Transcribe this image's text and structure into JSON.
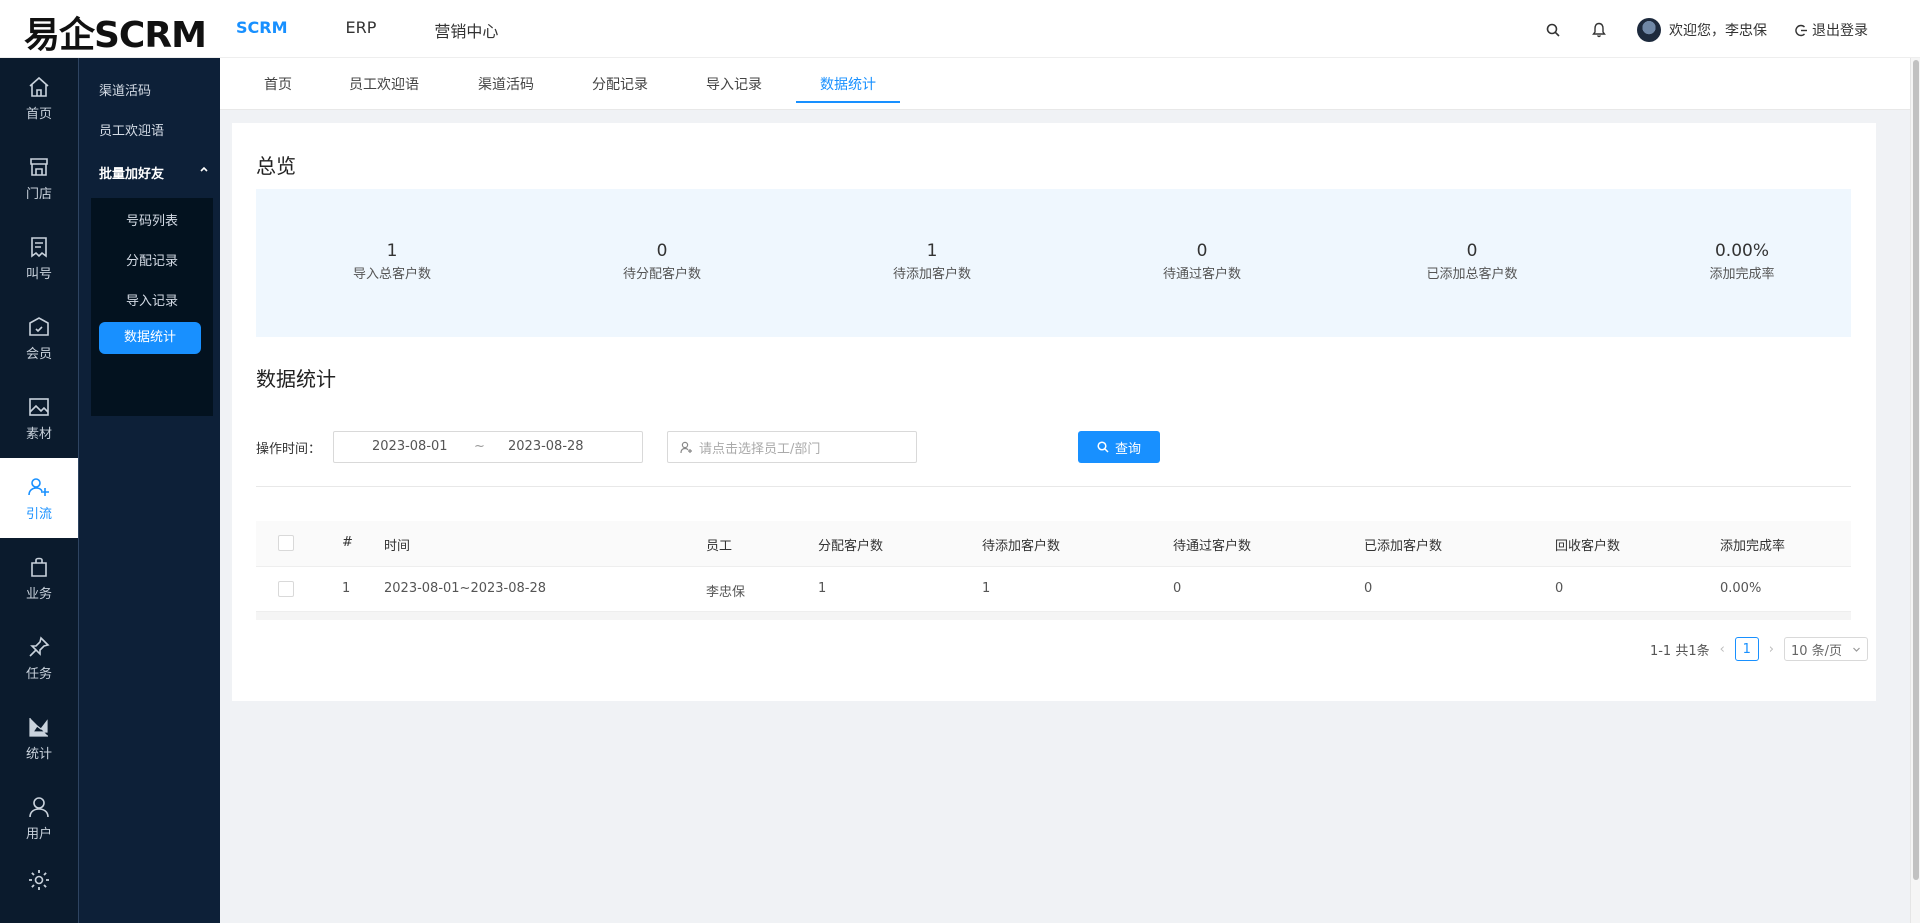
{
  "app": {
    "logo": "易企SCRM"
  },
  "topnav": {
    "items": [
      "SCRM",
      "ERP",
      "营销中心"
    ],
    "active": "SCRM"
  },
  "header": {
    "welcome": "欢迎您，李忠保",
    "logout": "退出登录"
  },
  "rail": {
    "items": [
      {
        "label": "首页",
        "icon": "home-icon"
      },
      {
        "label": "门店",
        "icon": "store-icon"
      },
      {
        "label": "叫号",
        "icon": "queue-icon"
      },
      {
        "label": "会员",
        "icon": "member-icon"
      },
      {
        "label": "素材",
        "icon": "image-icon"
      },
      {
        "label": "引流",
        "icon": "users-plus-icon"
      },
      {
        "label": "业务",
        "icon": "bag-icon"
      },
      {
        "label": "任务",
        "icon": "pin-icon"
      },
      {
        "label": "统计",
        "icon": "chart-icon"
      },
      {
        "label": "用户",
        "icon": "user-icon"
      }
    ],
    "active": "引流"
  },
  "submenu": {
    "items": [
      "渠道活码",
      "员工欢迎语"
    ],
    "group": "批量加好友",
    "children": [
      "号码列表",
      "分配记录",
      "导入记录",
      "数据统计"
    ],
    "active": "数据统计"
  },
  "tabs": {
    "items": [
      "首页",
      "员工欢迎语",
      "渠道活码",
      "分配记录",
      "导入记录",
      "数据统计"
    ],
    "active": "数据统计"
  },
  "overview": {
    "title": "总览",
    "stats": [
      {
        "value": "1",
        "label": "导入总客户数"
      },
      {
        "value": "0",
        "label": "待分配客户数"
      },
      {
        "value": "1",
        "label": "待添加客户数"
      },
      {
        "value": "0",
        "label": "待通过客户数"
      },
      {
        "value": "0",
        "label": "已添加总客户数"
      },
      {
        "value": "0.00%",
        "label": "添加完成率"
      }
    ]
  },
  "stats": {
    "title": "数据统计",
    "filter": {
      "label": "操作时间：",
      "start_date": "2023-08-01",
      "separator": "~",
      "end_date": "2023-08-28",
      "employee_placeholder": "请点击选择员工/部门",
      "query_label": "查询"
    },
    "table": {
      "headers": [
        "#",
        "时间",
        "员工",
        "分配客户数",
        "待添加客户数",
        "待通过客户数",
        "已添加客户数",
        "回收客户数",
        "添加完成率"
      ],
      "rows": [
        [
          "1",
          "2023-08-01~2023-08-28",
          "李忠保",
          "1",
          "1",
          "0",
          "0",
          "0",
          "0.00%"
        ]
      ]
    },
    "pagination": {
      "summary": "1-1 共1条",
      "page": "1",
      "page_size": "10 条/页"
    }
  },
  "colors": {
    "primary": "#1890ff",
    "sidebar": "#0b1b2d",
    "overview_bg": "#eff7fe"
  }
}
